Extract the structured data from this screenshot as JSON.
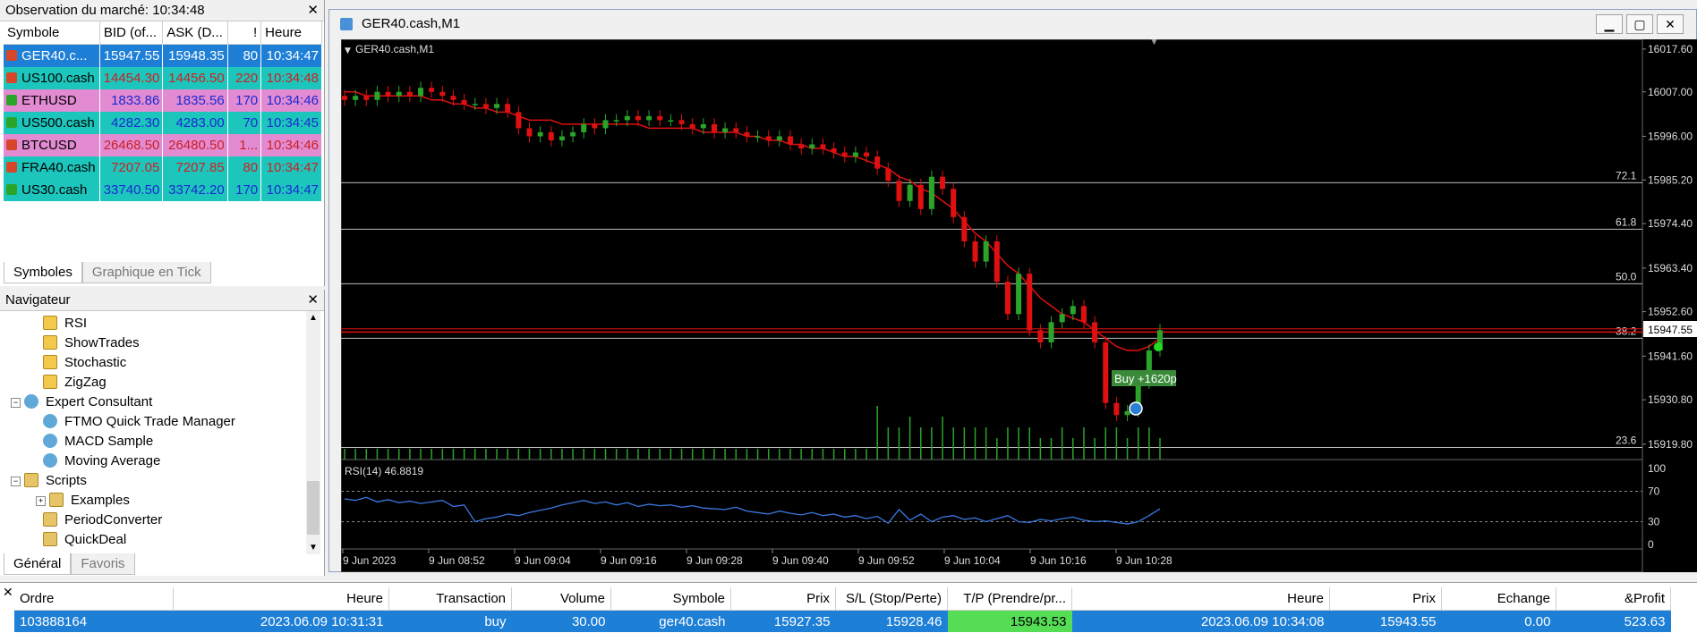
{
  "market_watch": {
    "title": "Observation du marché: 10:34:48",
    "columns": [
      "Symbole",
      "BID (of...",
      "ASK (D...",
      "!",
      "Heure"
    ],
    "rows": [
      {
        "symbol": "GER40.c...",
        "bid": "15947.55",
        "ask": "15948.35",
        "spread": "80",
        "time": "10:34:47",
        "dir": "down",
        "bg": "#1e7fd7",
        "fg": "#ffffff"
      },
      {
        "symbol": "US100.cash",
        "bid": "14454.30",
        "ask": "14456.50",
        "spread": "220",
        "time": "10:34:48",
        "dir": "down",
        "bg": "#1dc6bd",
        "fg": "#cc2020"
      },
      {
        "symbol": "ETHUSD",
        "bid": "1833.86",
        "ask": "1835.56",
        "spread": "170",
        "time": "10:34:46",
        "dir": "up",
        "bg": "#e28bd2",
        "fg": "#1a2ad0"
      },
      {
        "symbol": "US500.cash",
        "bid": "4282.30",
        "ask": "4283.00",
        "spread": "70",
        "time": "10:34:45",
        "dir": "up",
        "bg": "#1dc6bd",
        "fg": "#1a2ad0"
      },
      {
        "symbol": "BTCUSD",
        "bid": "26468.50",
        "ask": "26480.50",
        "spread": "1...",
        "time": "10:34:46",
        "dir": "down",
        "bg": "#e28bd2",
        "fg": "#cc2020"
      },
      {
        "symbol": "FRA40.cash",
        "bid": "7207.05",
        "ask": "7207.85",
        "spread": "80",
        "time": "10:34:47",
        "dir": "down",
        "bg": "#1dc6bd",
        "fg": "#cc2020"
      },
      {
        "symbol": "US30.cash",
        "bid": "33740.50",
        "ask": "33742.20",
        "spread": "170",
        "time": "10:34:47",
        "dir": "up",
        "bg": "#1dc6bd",
        "fg": "#1a2ad0"
      }
    ],
    "tabs": [
      "Symboles",
      "Graphique en Tick"
    ]
  },
  "navigator": {
    "title": "Navigateur",
    "items": [
      {
        "label": "RSI",
        "icon": "indicator-icon",
        "level": 2
      },
      {
        "label": "ShowTrades",
        "icon": "indicator-icon",
        "level": 2
      },
      {
        "label": "Stochastic",
        "icon": "indicator-icon",
        "level": 2
      },
      {
        "label": "ZigZag",
        "icon": "indicator-icon",
        "level": 2
      },
      {
        "label": "Expert Consultant",
        "icon": "expert-icon",
        "level": 1,
        "expander": "−"
      },
      {
        "label": "FTMO Quick Trade Manager",
        "icon": "expert-icon",
        "level": 2
      },
      {
        "label": "MACD Sample",
        "icon": "expert-icon",
        "level": 2
      },
      {
        "label": "Moving Average",
        "icon": "expert-icon",
        "level": 2
      },
      {
        "label": "Scripts",
        "icon": "script-icon",
        "level": 1,
        "expander": "−"
      },
      {
        "label": "Examples",
        "icon": "script-icon",
        "level": 2,
        "expander": "+"
      },
      {
        "label": "PeriodConverter",
        "icon": "script-icon",
        "level": 2
      },
      {
        "label": "QuickDeal",
        "icon": "script-icon",
        "level": 2
      }
    ],
    "tabs": [
      "Général",
      "Favoris"
    ]
  },
  "chart_window": {
    "title": "GER40.cash,M1",
    "label": "GER40.cash,M1",
    "rsi_label": "RSI(14) 46.8819",
    "trade_label": "Buy +1620p",
    "current_price": "15947.55"
  },
  "chart_data": {
    "type": "candlestick",
    "symbol": "GER40.cash",
    "timeframe": "M1",
    "y_ticks": [
      "16017.60",
      "16007.00",
      "15996.00",
      "15985.20",
      "15974.40",
      "15963.40",
      "15952.60",
      "15941.60",
      "15930.80",
      "15919.80"
    ],
    "ylim": [
      15916,
      16020
    ],
    "x_ticks": [
      "9 Jun 2023",
      "9 Jun 08:52",
      "9 Jun 09:04",
      "9 Jun 09:16",
      "9 Jun 09:28",
      "9 Jun 09:40",
      "9 Jun 09:52",
      "9 Jun 10:04",
      "9 Jun 10:16",
      "9 Jun 10:28"
    ],
    "fib_levels": [
      {
        "label": "72.1",
        "price": 15984.5
      },
      {
        "label": "61.8",
        "price": 15973.0
      },
      {
        "label": "50.0",
        "price": 15959.5
      },
      {
        "label": "38.2",
        "price": 15946.0
      },
      {
        "label": "23.6",
        "price": 15919.0
      }
    ],
    "closes": [
      16005,
      16006,
      16005,
      16007,
      16006,
      16007,
      16006,
      16008,
      16007,
      16006,
      16005,
      16004,
      16004,
      16003,
      16004,
      16002,
      15998,
      15996,
      15997,
      15995,
      15996,
      15997,
      15999,
      15998,
      16000,
      16000,
      16001,
      16000,
      16001,
      16000,
      16000,
      15999,
      15998,
      15999,
      15997,
      15998,
      15997,
      15996,
      15996,
      15995,
      15996,
      15994,
      15993,
      15994,
      15993,
      15992,
      15991,
      15992,
      15991,
      15988,
      15985,
      15980,
      15984,
      15978,
      15986,
      15983,
      15976,
      15970,
      15965,
      15970,
      15960,
      15952,
      15962,
      15948,
      15945,
      15950,
      15952,
      15954,
      15950,
      15945,
      15930,
      15927,
      15928,
      15935,
      15943,
      15948
    ],
    "ma": [
      16007,
      16007,
      16006,
      16006,
      16006,
      16006,
      16006,
      16006,
      16005,
      16005,
      16004,
      16004,
      16003,
      16003,
      16002,
      16002,
      16001,
      16000,
      16000,
      16000,
      15999,
      15999,
      15999,
      15999,
      15999,
      15999,
      15999,
      15999,
      15998,
      15998,
      15998,
      15998,
      15998,
      15997,
      15997,
      15997,
      15997,
      15996,
      15996,
      15995,
      15995,
      15994,
      15994,
      15993,
      15993,
      15992,
      15991,
      15991,
      15990,
      15989,
      15988,
      15986,
      15985,
      15983,
      15982,
      15980,
      15978,
      15975,
      15972,
      15970,
      15967,
      15964,
      15962,
      15959,
      15956,
      15954,
      15952,
      15951,
      15950,
      15948,
      15946,
      15944,
      15943,
      15943,
      15944,
      15946
    ],
    "volume": [
      1,
      1,
      1,
      1,
      1,
      1,
      1,
      1,
      1,
      1,
      1,
      1,
      1,
      1,
      1,
      1,
      1,
      1,
      1,
      1,
      1,
      1,
      1,
      1,
      1,
      1,
      1,
      1,
      1,
      1,
      1,
      1,
      1,
      1,
      1,
      1,
      1,
      1,
      1,
      1,
      1,
      1,
      1,
      1,
      1,
      1,
      1,
      1,
      1,
      5,
      3,
      3,
      4,
      3,
      3,
      4,
      3,
      3,
      3,
      3,
      2,
      3,
      3,
      3,
      2,
      2,
      3,
      2,
      3,
      2,
      3,
      3,
      2,
      3,
      3,
      2
    ],
    "rsi": {
      "label": "RSI(14) 46.8819",
      "levels": [
        100,
        70,
        30,
        0
      ],
      "values": [
        60,
        58,
        62,
        56,
        59,
        55,
        57,
        54,
        56,
        58,
        50,
        52,
        30,
        34,
        36,
        40,
        38,
        42,
        45,
        48,
        52,
        55,
        58,
        54,
        56,
        52,
        55,
        50,
        53,
        51,
        52,
        49,
        51,
        48,
        47,
        46,
        49,
        44,
        42,
        40,
        44,
        41,
        39,
        42,
        38,
        40,
        36,
        38,
        34,
        37,
        28,
        46,
        32,
        40,
        30,
        36,
        38,
        33,
        35,
        30,
        34,
        38,
        30,
        29,
        33,
        31,
        34,
        36,
        32,
        30,
        31,
        29,
        27,
        30,
        38,
        47
      ]
    }
  },
  "trades": {
    "columns": [
      "Ordre",
      "Heure",
      "Transaction",
      "Volume",
      "Symbole",
      "Prix",
      "S/L (Stop/Perte)",
      "T/P (Prendre/pr...",
      "Heure",
      "Prix",
      "Echange",
      "&Profit"
    ],
    "row": [
      "103888164",
      "2023.06.09 10:31:31",
      "buy",
      "30.00",
      "ger40.cash",
      "15927.35",
      "15928.46",
      "15943.53",
      "2023.06.09 10:34:08",
      "15943.55",
      "0.00",
      "523.63"
    ]
  }
}
